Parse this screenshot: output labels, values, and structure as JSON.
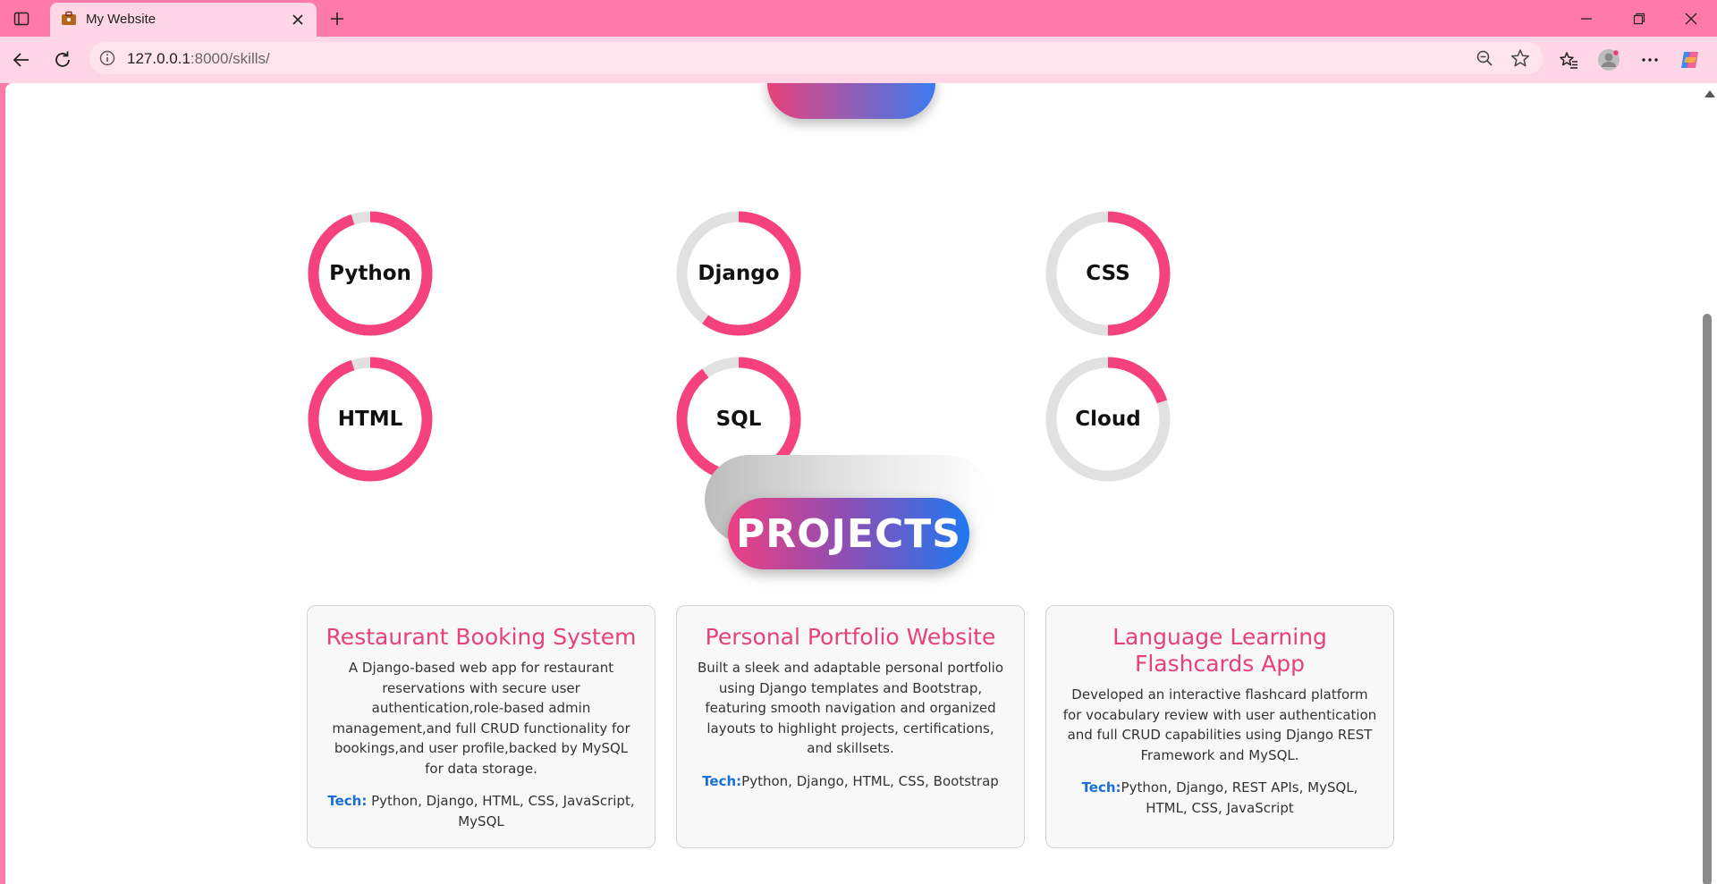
{
  "browser": {
    "tab_title": "My Website",
    "url_host": "127.0.0.1",
    "url_path": ":8000/skills/",
    "accent_color": "#ff7aa8"
  },
  "skills": [
    {
      "name": "Python",
      "level": 0.95
    },
    {
      "name": "Django",
      "level": 0.6
    },
    {
      "name": "CSS",
      "level": 0.5
    },
    {
      "name": "HTML",
      "level": 0.95
    },
    {
      "name": "SQL",
      "level": 0.9
    },
    {
      "name": "Cloud",
      "level": 0.2
    }
  ],
  "skill_colors": {
    "fill": "#f5417d",
    "track": "#e1e1e1"
  },
  "projects": {
    "heading": "PROJECTS",
    "tech_label": "Tech:",
    "items": [
      {
        "title": "Restaurant Booking System",
        "description": "A Django-based web app for restaurant reservations with secure user authentication,role-based admin management,and full CRUD functionality for bookings,and user profile,backed by MySQL for data storage.",
        "tech": " Python, Django, HTML, CSS, JavaScript, MySQL"
      },
      {
        "title": "Personal Portfolio Website",
        "description": "Built a sleek and adaptable personal portfolio using Django templates and Bootstrap, featuring smooth navigation and organized layouts to highlight projects, certifications, and skillsets.",
        "tech": "Python, Django, HTML, CSS, Bootstrap"
      },
      {
        "title": "Language Learning Flashcards App",
        "description": "Developed an interactive flashcard platform for vocabulary review with user authentication and full CRUD capabilities using Django REST Framework and MySQL.",
        "tech": "Python, Django, REST APIs, MySQL, HTML, CSS, JavaScript"
      }
    ]
  }
}
